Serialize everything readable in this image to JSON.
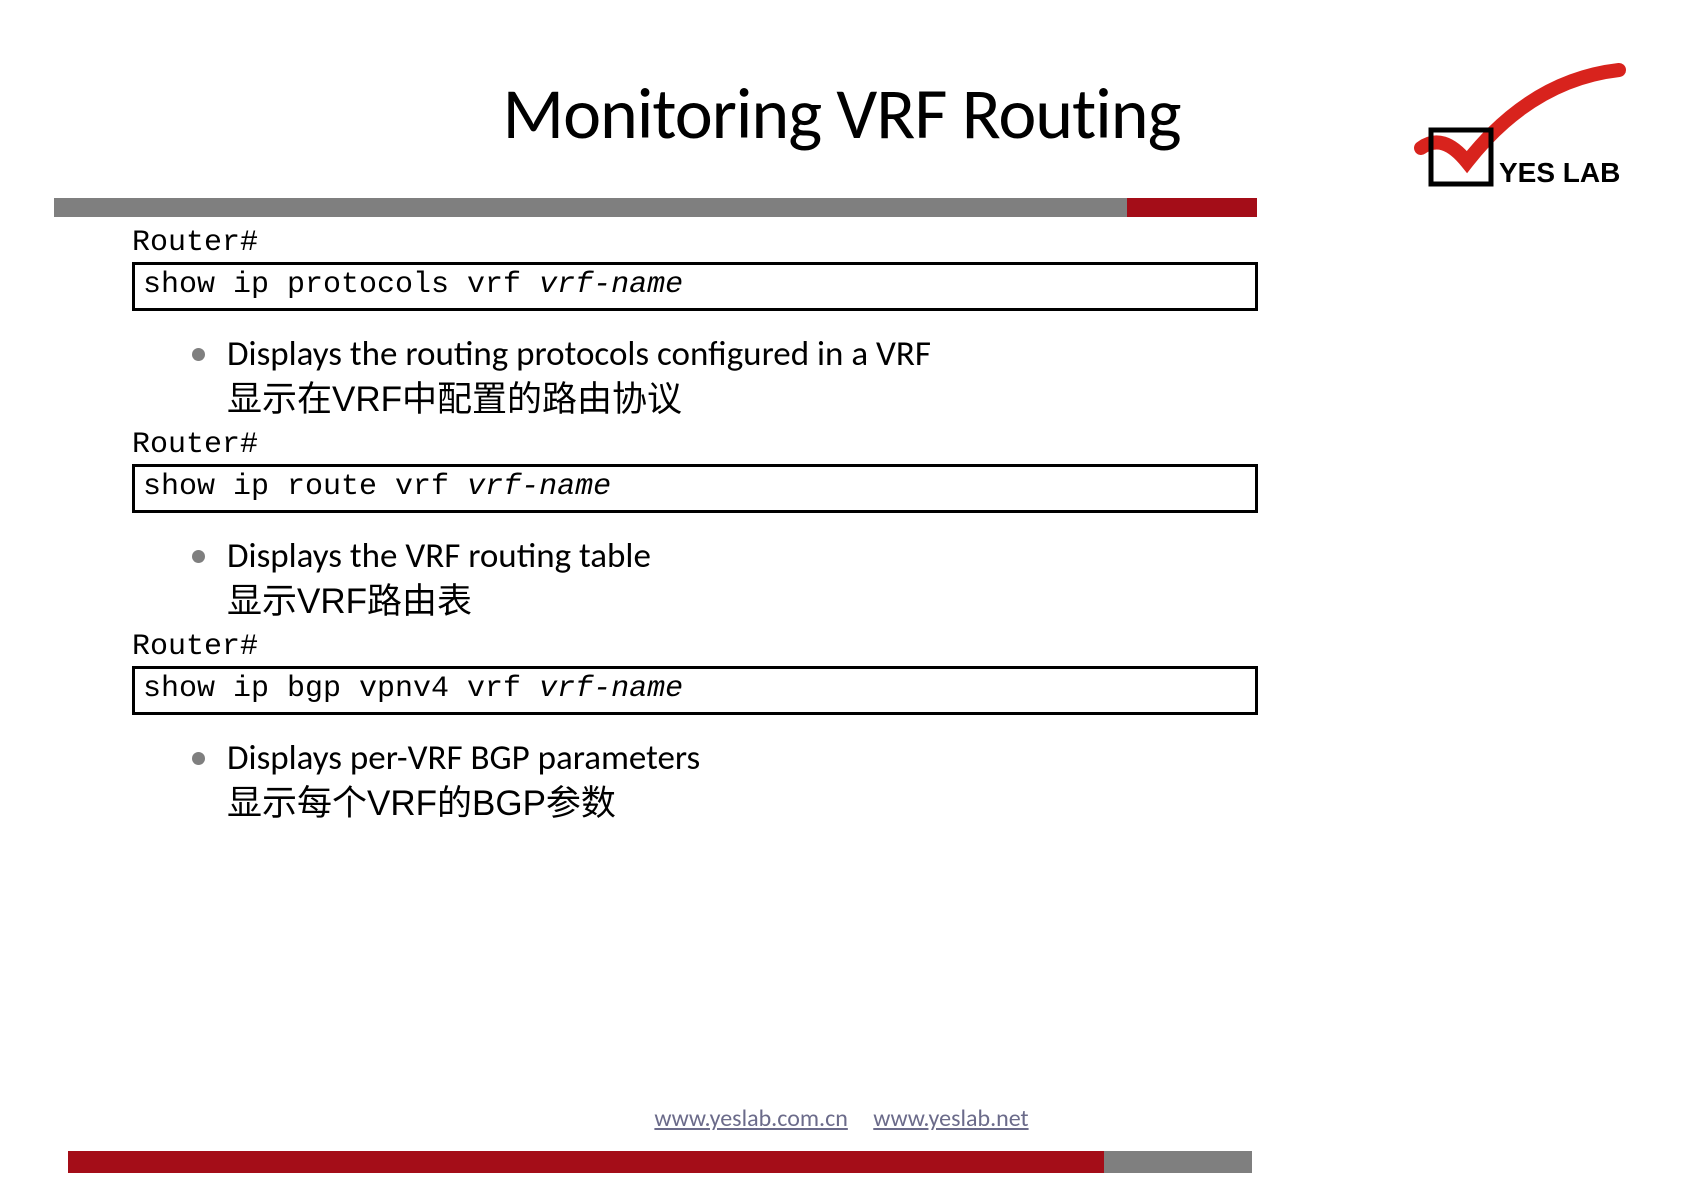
{
  "title": "Monitoring VRF Routing",
  "logo_text": "YES LAB",
  "items": [
    {
      "prompt": "Router#",
      "cmd_prefix": "show ip protocols vrf ",
      "cmd_arg": "vrf-name",
      "bullet_en": "Displays the routing protocols configured in a VRF",
      "bullet_cn": "显示在VRF中配置的路由协议"
    },
    {
      "prompt": "Router#",
      "cmd_prefix": "show ip route vrf ",
      "cmd_arg": "vrf-name",
      "bullet_en": "Displays the VRF routing table",
      "bullet_cn": "显示VRF路由表"
    },
    {
      "prompt": "Router#",
      "cmd_prefix": "show ip bgp vpnv4 vrf ",
      "cmd_arg": "vrf-name",
      "bullet_en": "Displays per-VRF BGP parameters",
      "bullet_cn": "显示每个VRF的BGP参数"
    }
  ],
  "footer": {
    "link1": "www.yeslab.com.cn",
    "link2": "www.yeslab.net"
  }
}
